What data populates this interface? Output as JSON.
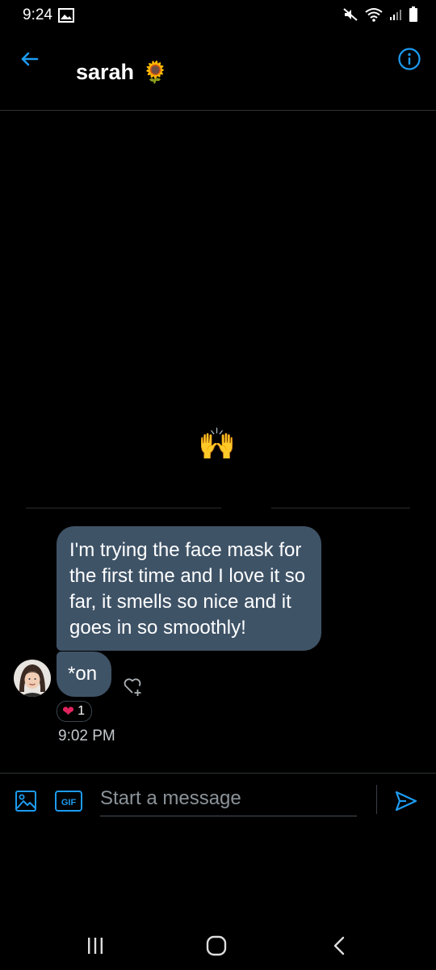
{
  "status_bar": {
    "time": "9:24"
  },
  "header": {
    "contact_name": "sarah",
    "name_emoji": "🌻"
  },
  "conversation": {
    "emoji_message": "🙌",
    "messages": [
      {
        "text": "I'm trying the face mask for the first time and I love it so far, it smells so nice and it goes in so smoothly!"
      },
      {
        "text": "*on"
      }
    ],
    "reaction": {
      "emoji": "❤",
      "count": "1"
    },
    "timestamp": "9:02 PM"
  },
  "composer": {
    "placeholder": "Start a message",
    "gif_label": "GIF"
  },
  "colors": {
    "accent": "#1d9bf0",
    "bubble": "#3f5367",
    "background": "#000000"
  }
}
